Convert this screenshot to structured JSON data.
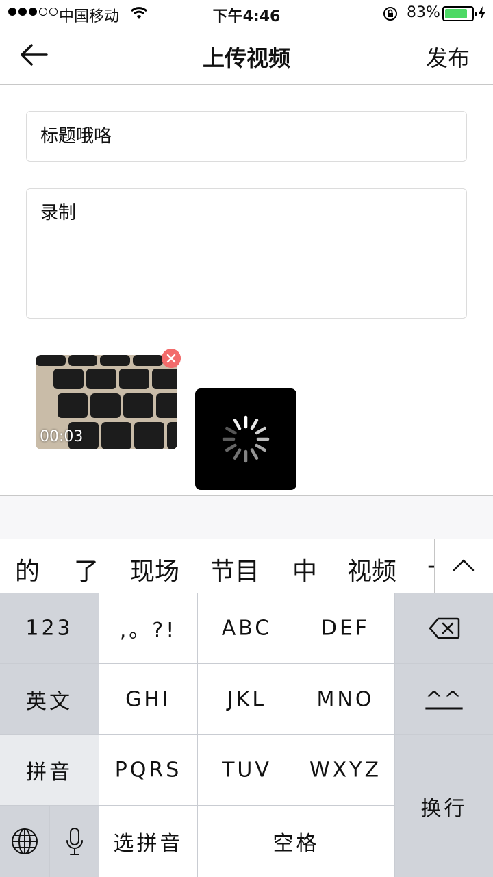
{
  "status_bar": {
    "carrier": "中国移动",
    "time": "下午4:46",
    "battery_percent": "83%",
    "battery_level": 0.83,
    "signal_bars_filled": 3,
    "signal_bars_total": 5
  },
  "navbar": {
    "back_icon": "arrow-left-icon",
    "title": "上传视频",
    "publish_label": "发布"
  },
  "form": {
    "title_value": "标题哦咯",
    "description_value": "录制"
  },
  "media": {
    "video_duration": "00:03",
    "remove_icon": "close-icon",
    "uploading_icon": "spinner-icon"
  },
  "candidates": {
    "words": [
      "的",
      "了",
      "现场",
      "节目",
      "中",
      "视频",
      "-"
    ],
    "collapse_icon": "chevron-up-icon"
  },
  "keyboard": {
    "numbers": "123",
    "punct": ",。?!",
    "abc": "ABC",
    "def": "DEF",
    "delete_icon": "backspace-icon",
    "english": "英文",
    "ghi": "GHI",
    "jkl": "JKL",
    "mno": "MNO",
    "emoticon": "^^",
    "pinyin": "拼音",
    "pqrs": "PQRS",
    "tuv": "TUV",
    "wxyz": "WXYZ",
    "return": "换行",
    "globe_icon": "globe-icon",
    "mic_icon": "microphone-icon",
    "select_pinyin": "选拼音",
    "space": "空格"
  },
  "colors": {
    "battery_fill": "#4cd964",
    "remove_badge": "#f26b6b",
    "keyboard_bg": "#c9ccd2",
    "function_key": "#d1d4da"
  }
}
